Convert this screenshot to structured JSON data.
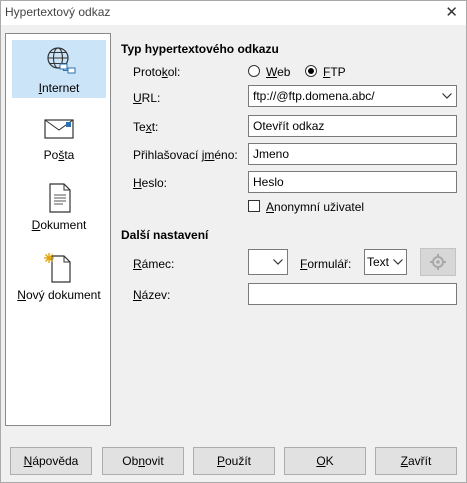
{
  "window": {
    "title": "Hypertextový odkaz",
    "close_glyph": "✕"
  },
  "sidebar": {
    "items": [
      {
        "pre": "",
        "mn": "I",
        "post": "nternet",
        "icon": "globe-network-icon",
        "selected": true
      },
      {
        "pre": "Po",
        "mn": "š",
        "post": "ta",
        "icon": "envelope-icon",
        "selected": false
      },
      {
        "pre": "",
        "mn": "D",
        "post": "okument",
        "icon": "document-icon",
        "selected": false
      },
      {
        "pre": "",
        "mn": "N",
        "post": "ový dokument",
        "icon": "new-document-icon",
        "selected": false
      }
    ]
  },
  "type_section": {
    "heading": "Typ hypertextového odkazu",
    "protocol_label": {
      "pre": "Proto",
      "mn": "k",
      "post": "ol:"
    },
    "web": {
      "pre": "",
      "mn": "W",
      "post": "eb",
      "checked": false
    },
    "ftp": {
      "pre": "",
      "mn": "F",
      "post": "TP",
      "checked": true
    },
    "url_label": {
      "pre": "",
      "mn": "U",
      "post": "RL:"
    },
    "url_value": "ftp://@ftp.domena.abc/",
    "text_label": {
      "pre": "Te",
      "mn": "x",
      "post": "t:"
    },
    "text_value": "Otevřít odkaz",
    "login_label": {
      "pre": "Přihlašovací j",
      "mn": "m",
      "post": "éno:"
    },
    "login_value": "Jmeno",
    "password_label": {
      "pre": "",
      "mn": "H",
      "post": "eslo:"
    },
    "password_value": "Heslo",
    "anonymous": {
      "pre": "",
      "mn": "A",
      "post": "nonymní uživatel",
      "checked": false
    }
  },
  "more_section": {
    "heading": "Další nastavení",
    "frame_label": {
      "pre": "",
      "mn": "R",
      "post": "ámec:"
    },
    "frame_value": "",
    "form_label": {
      "pre": "",
      "mn": "F",
      "post": "ormulář:"
    },
    "form_value": "Text",
    "name_label": {
      "pre": "",
      "mn": "N",
      "post": "ázev:"
    },
    "name_value": "",
    "events_icon": "events-macro-icon"
  },
  "buttons": {
    "help": {
      "pre": "",
      "mn": "N",
      "post": "ápověda"
    },
    "reset": {
      "pre": "Ob",
      "mn": "n",
      "post": "ovit"
    },
    "apply": {
      "pre": "",
      "mn": "P",
      "post": "oužít"
    },
    "ok": {
      "pre": "",
      "mn": "O",
      "post": "K"
    },
    "close": {
      "pre": "",
      "mn": "Z",
      "post": "avřít"
    }
  },
  "colors": {
    "selection": "#cce4f7",
    "window_bg": "#f0f0f0",
    "field_border": "#7a7a7a"
  }
}
